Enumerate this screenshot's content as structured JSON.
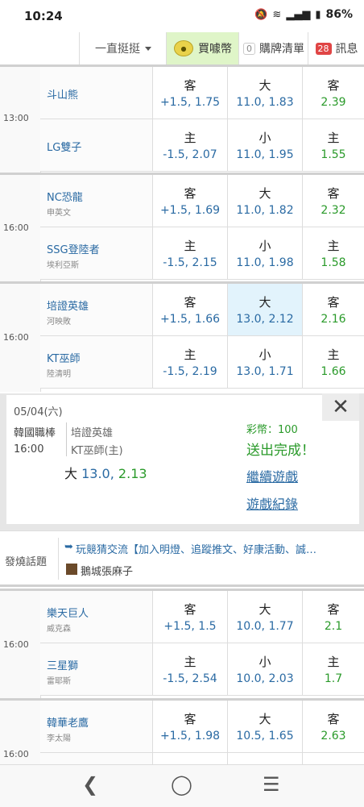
{
  "status": {
    "time": "10:24",
    "battery": "86%"
  },
  "nav": {
    "dropdown": "一直挺挺",
    "buy": "買噱幣",
    "cart_count": "0",
    "cart": "購牌清單",
    "msg_count": "28",
    "msg": "訊息"
  },
  "games": [
    {
      "time": "13:00",
      "away": {
        "name": "斗山熊",
        "pitcher": ""
      },
      "home": {
        "name": "LG雙子",
        "pitcher": ""
      },
      "row1": {
        "spread_label": "客",
        "spread": "+1.5, 1.75",
        "total_label": "大",
        "total": "11.0, 1.83",
        "ml_label": "客",
        "ml": "2.39"
      },
      "row2": {
        "spread_label": "主",
        "spread": "-1.5, 2.07",
        "total_label": "小",
        "total": "11.0, 1.95",
        "ml_label": "主",
        "ml": "1.55"
      }
    },
    {
      "time": "16:00",
      "away": {
        "name": "NC恐龍",
        "pitcher": "申英文"
      },
      "home": {
        "name": "SSG登陸者",
        "pitcher": "埃利亞斯"
      },
      "row1": {
        "spread_label": "客",
        "spread": "+1.5, 1.69",
        "total_label": "大",
        "total": "11.0, 1.82",
        "ml_label": "客",
        "ml": "2.32"
      },
      "row2": {
        "spread_label": "主",
        "spread": "-1.5, 2.15",
        "total_label": "小",
        "total": "11.0, 1.98",
        "ml_label": "主",
        "ml": "1.58"
      }
    },
    {
      "time": "16:00",
      "away": {
        "name": "培證英雄",
        "pitcher": "河映敗"
      },
      "home": {
        "name": "KT巫師",
        "pitcher": "陸清明"
      },
      "row1": {
        "spread_label": "客",
        "spread": "+1.5, 1.66",
        "total_label": "大",
        "total": "13.0, 2.12",
        "ml_label": "客",
        "ml": "2.16"
      },
      "row2": {
        "spread_label": "主",
        "spread": "-1.5, 2.19",
        "total_label": "小",
        "total": "13.0, 1.71",
        "ml_label": "主",
        "ml": "1.66"
      }
    },
    {
      "time": "16:00",
      "away": {
        "name": "樂天巨人",
        "pitcher": "威克森"
      },
      "home": {
        "name": "三星獅",
        "pitcher": "雷耶斯"
      },
      "row1": {
        "spread_label": "客",
        "spread": "+1.5, 1.5",
        "total_label": "大",
        "total": "10.0, 1.77",
        "ml_label": "客",
        "ml": "2.1"
      },
      "row2": {
        "spread_label": "主",
        "spread": "-1.5, 2.54",
        "total_label": "小",
        "total": "10.0, 2.03",
        "ml_label": "主",
        "ml": "1.7"
      }
    },
    {
      "time": "16:00",
      "away": {
        "name": "韓華老鷹",
        "pitcher": "李太陽"
      },
      "home": {
        "name": "",
        "pitcher": ""
      },
      "row1": {
        "spread_label": "客",
        "spread": "+1.5, 1.98",
        "total_label": "大",
        "total": "10.5, 1.65",
        "ml_label": "客",
        "ml": "2.63"
      },
      "row2": {
        "spread_label": "",
        "spread": "",
        "total_label": "",
        "total": "",
        "ml_label": "",
        "ml": ""
      }
    }
  ],
  "popup": {
    "date": "05/04(六)",
    "league": "韓國職棒",
    "time": "16:00",
    "team1": "培證英雄",
    "team2": "KT巫師(主)",
    "pick_label": "大",
    "pick_value": "13.0,",
    "pick_odds": "2.13",
    "coins": "彩幣：100",
    "done": "送出完成！",
    "continue": "繼續遊戲",
    "record": "遊戲紀錄"
  },
  "hot": {
    "label": "發燒話題",
    "title": "玩競猜交流【加入明燈、追蹤推文、好康活動、誠…",
    "author": "鵝城張麻子"
  }
}
